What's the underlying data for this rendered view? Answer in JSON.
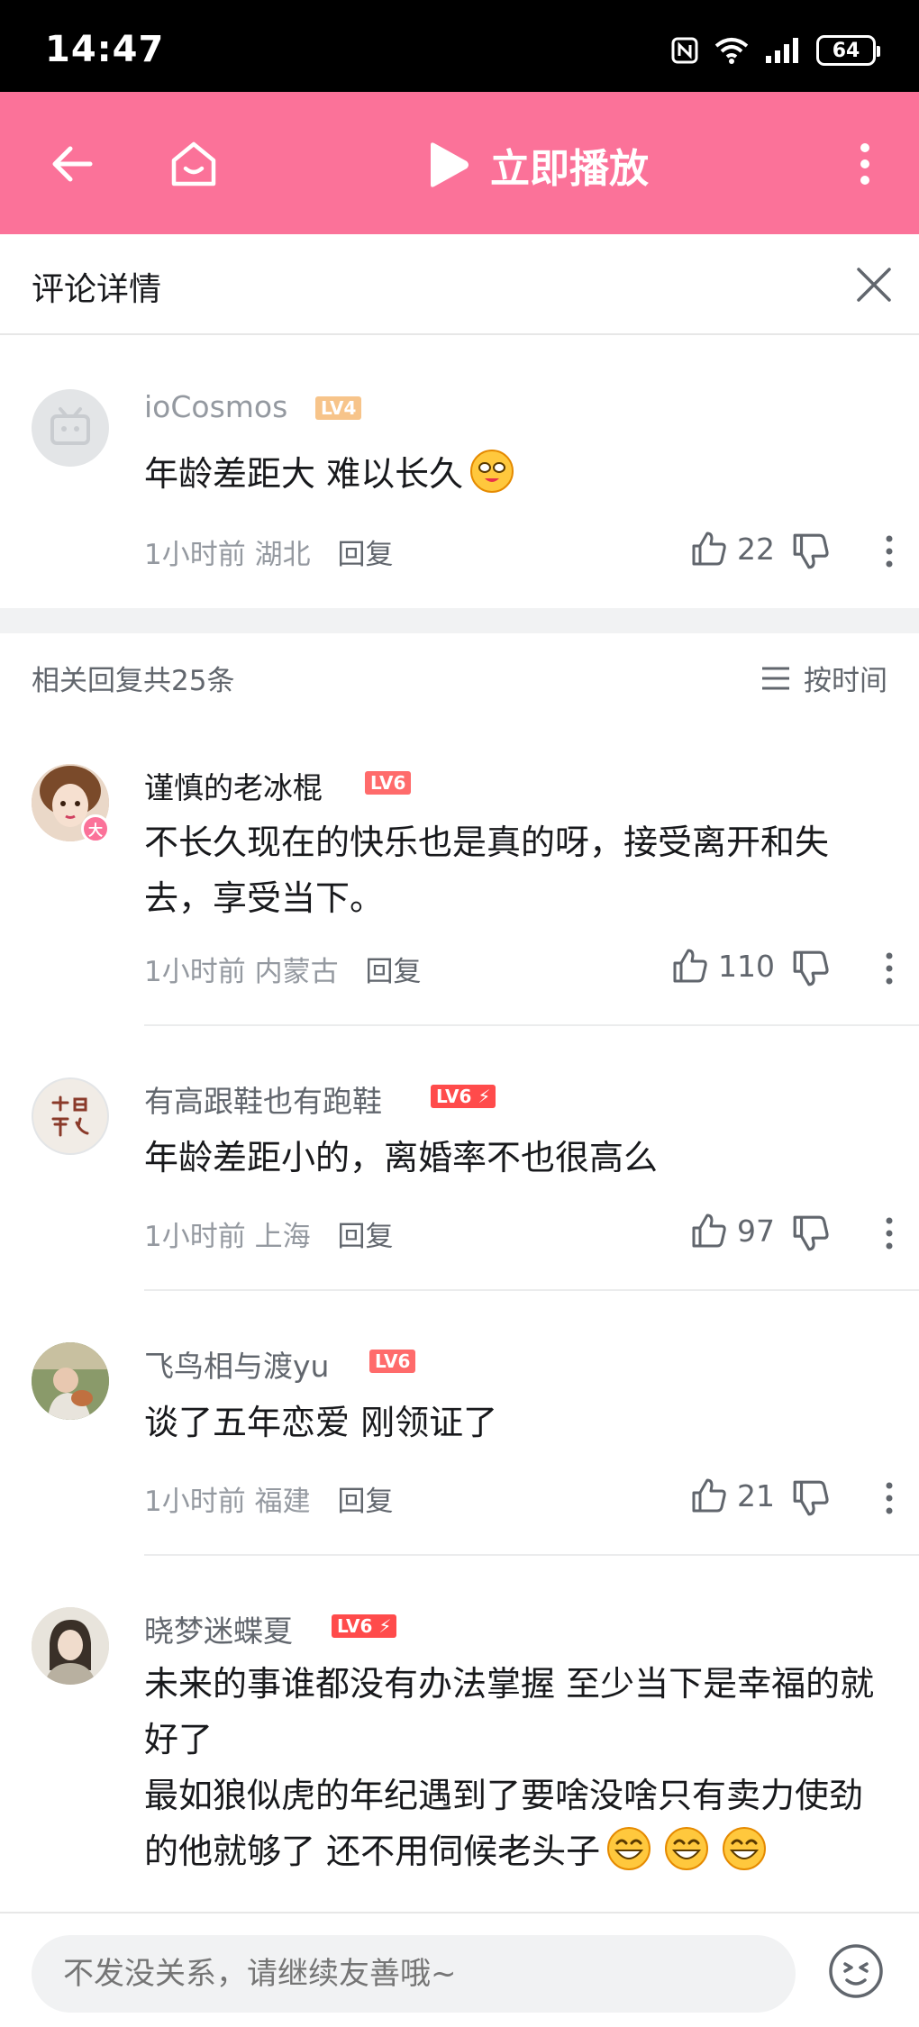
{
  "status_bar": {
    "time": "14:47",
    "battery": "64"
  },
  "top_bar": {
    "play_label": "立即播放",
    "accent": "#fb7299"
  },
  "panel": {
    "title": "评论详情"
  },
  "root_comment": {
    "username": "ioCosmos",
    "level": "LV4",
    "level_color": "#f7c48a",
    "content": "年龄差距大 难以长久",
    "time": "1小时前",
    "location": "湖北",
    "reply_label": "回复",
    "likes": "22"
  },
  "replies_header": {
    "count_text": "相关回复共25条",
    "sort_label": "按时间"
  },
  "replies": [
    {
      "username": "谨慎的老冰棍",
      "level": "LV6",
      "level_color": "#ff6b6b",
      "name_color": "#fb7299",
      "content": "不长久现在的快乐也是真的呀，接受离开和失去，享受当下。",
      "time": "1小时前",
      "location": "内蒙古",
      "reply_label": "回复",
      "likes": "110"
    },
    {
      "username": "有高跟鞋也有跑鞋",
      "level": "LV6",
      "level_color": "#ff4b4b",
      "name_color": "#61666d",
      "content": "年龄差距小的，离婚率不也很高么",
      "time": "1小时前",
      "location": "上海",
      "reply_label": "回复",
      "likes": "97"
    },
    {
      "username": "飞鸟相与渡yu",
      "level": "LV6",
      "level_color": "#ff6b6b",
      "name_color": "#61666d",
      "content": "谈了五年恋爱 刚领证了",
      "time": "1小时前",
      "location": "福建",
      "reply_label": "回复",
      "likes": "21"
    },
    {
      "username": "晓梦迷蝶夏",
      "level": "LV6",
      "level_color": "#ff4b4b",
      "name_color": "#61666d",
      "content_line1": "未来的事谁都没有办法掌握 至少当下是幸福的就好了",
      "content_line2": "最如狼似虎的年纪遇到了要啥没啥只有卖力使劲的他就够了 还不用伺候老头子"
    }
  ],
  "bottom_bar": {
    "placeholder": "不发没关系，请继续友善哦~"
  }
}
